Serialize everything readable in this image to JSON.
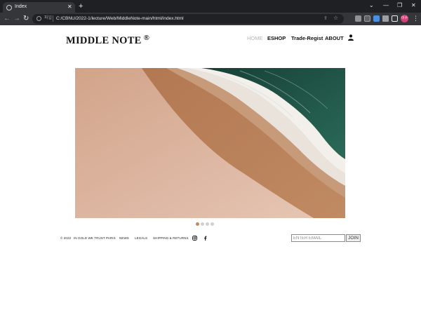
{
  "browser": {
    "tab_title": "Index",
    "tab_close": "✕",
    "new_tab": "+",
    "win_min": "—",
    "win_restore": "❐",
    "win_close": "✕",
    "win_chevron": "⌄",
    "nav_back": "←",
    "nav_forward": "→",
    "nav_reload": "↻",
    "url_scheme": "파일",
    "url": "C:/CBNU/2022-1/lecture/Web/MiddleNote-main/html/index.html",
    "profile_initial": "이수",
    "menu": "⋮",
    "icons": [
      "info-icon",
      "share-icon",
      "star-icon",
      "extension-icon",
      "puzzle-icon",
      "sidepanel-icon"
    ]
  },
  "header": {
    "logo_text": "MIDDLE NOTE",
    "logo_mark": "®",
    "nav": {
      "home": "HOME",
      "eshop": "ESHOP",
      "trade": "Trade-Regist",
      "about": "ABOUT"
    }
  },
  "carousel": {
    "slide_count": 4,
    "active_index": 0,
    "active_color": "#c48a5a",
    "inactive_color": "#d0d0d0"
  },
  "footer": {
    "copyright": "© 2022",
    "links": [
      "IN GOLD WE TRUST PARIS",
      "NEWS",
      "LEGALS",
      "SHIPPING & RETURNS"
    ],
    "email_placeholder": "ENTER EMAIL",
    "join_label": "JOIN"
  },
  "colors": {
    "browser_dark": "#1f2023",
    "toolbar": "#35363a",
    "sea": "#1f5547",
    "sand": "#c08a62"
  }
}
